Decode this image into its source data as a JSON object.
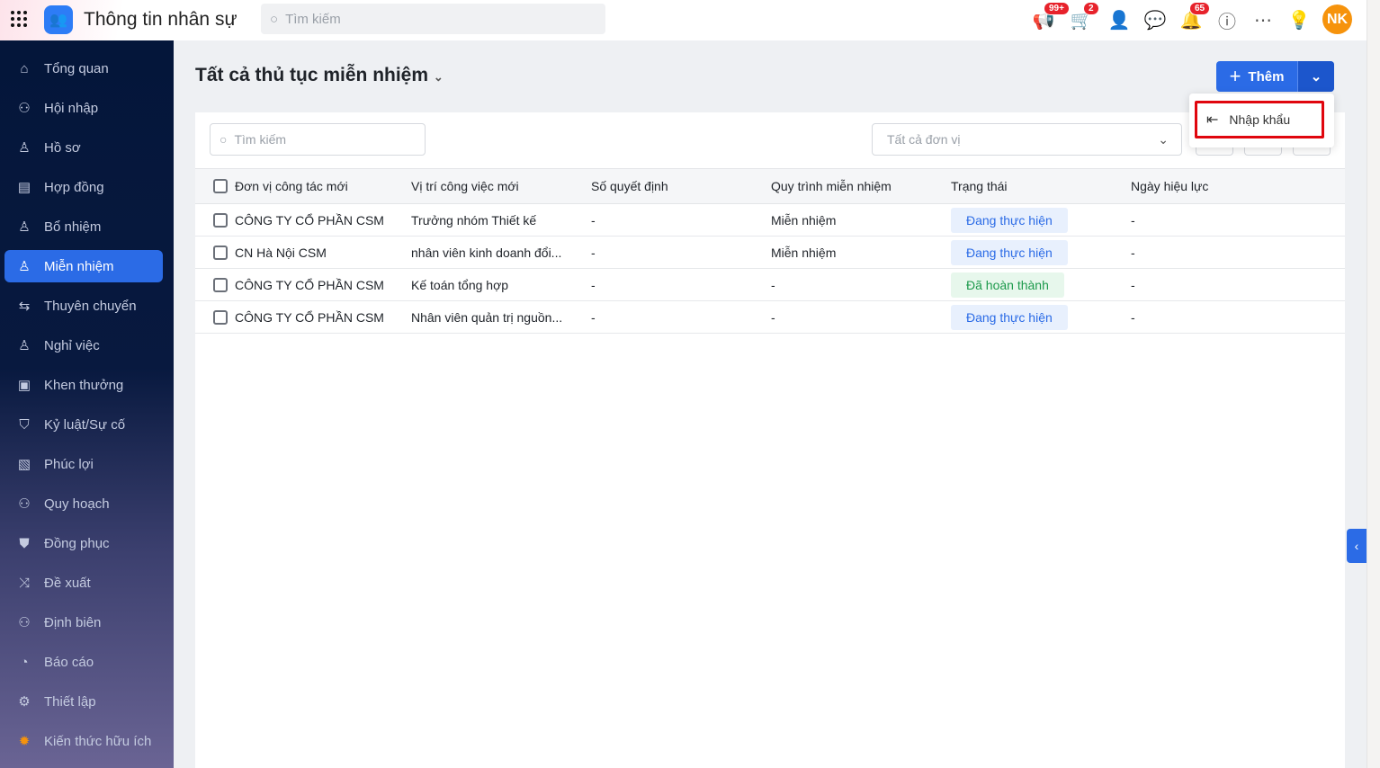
{
  "header": {
    "app_title": "Thông tin nhân sự",
    "search_placeholder": "Tìm kiếm",
    "badges": {
      "announcements": "99+",
      "cart": "2",
      "notifications": "65"
    },
    "avatar_initials": "NK"
  },
  "sidebar": {
    "items": [
      {
        "label": "Tổng quan",
        "icon": "home-icon"
      },
      {
        "label": "Hội nhập",
        "icon": "users-icon"
      },
      {
        "label": "Hồ sơ",
        "icon": "user-icon"
      },
      {
        "label": "Hợp đồng",
        "icon": "document-icon"
      },
      {
        "label": "Bổ nhiệm",
        "icon": "user-plus-icon"
      },
      {
        "label": "Miễn nhiệm",
        "icon": "user-minus-icon",
        "active": true
      },
      {
        "label": "Thuyên chuyển",
        "icon": "transfer-icon"
      },
      {
        "label": "Nghỉ việc",
        "icon": "user-leave-icon"
      },
      {
        "label": "Khen thưởng",
        "icon": "reward-icon"
      },
      {
        "label": "Kỷ luật/Sự cố",
        "icon": "shield-icon"
      },
      {
        "label": "Phúc lợi",
        "icon": "benefit-icon"
      },
      {
        "label": "Quy hoạch",
        "icon": "planning-icon"
      },
      {
        "label": "Đồng phục",
        "icon": "shirt-icon"
      },
      {
        "label": "Đề xuất",
        "icon": "proposal-icon"
      },
      {
        "label": "Định biên",
        "icon": "headcount-icon"
      },
      {
        "label": "Báo cáo",
        "icon": "pie-chart-icon"
      },
      {
        "label": "Thiết lập",
        "icon": "gear-icon"
      },
      {
        "label": "Kiến thức hữu ích",
        "icon": "lightbulb-book-icon"
      }
    ]
  },
  "main": {
    "title": "Tất cả thủ tục miễn nhiệm",
    "add_label": "Thêm",
    "dropdown_menu": {
      "import_label": "Nhập khẩu"
    },
    "search_placeholder": "Tìm kiếm",
    "unit_filter_placeholder": "Tất cả đơn vị",
    "table": {
      "columns": [
        "Đơn vị công tác mới",
        "Vị trí công việc mới",
        "Số quyết định",
        "Quy trình miễn nhiệm",
        "Trạng thái",
        "Ngày hiệu lực"
      ],
      "rows": [
        {
          "unit": "CÔNG TY CỔ PHẦN CSM",
          "position": "Trưởng nhóm Thiết kế",
          "decision": "-",
          "process": "Miễn nhiệm",
          "status": "Đang thực hiện",
          "status_type": "prog",
          "date": "-"
        },
        {
          "unit": "CN Hà Nội CSM",
          "position": "nhân viên kinh doanh đổi...",
          "decision": "-",
          "process": "Miễn nhiệm",
          "status": "Đang thực hiện",
          "status_type": "prog",
          "date": "-"
        },
        {
          "unit": "CÔNG TY CỔ PHẦN CSM",
          "position": "Kế toán tổng hợp",
          "decision": "-",
          "process": "-",
          "status": "Đã hoàn thành",
          "status_type": "done",
          "date": "-"
        },
        {
          "unit": "CÔNG TY CỔ PHẦN CSM",
          "position": "Nhân viên quản trị nguồn...",
          "decision": "-",
          "process": "-",
          "status": "Đang thực hiện",
          "status_type": "prog",
          "date": "-"
        }
      ]
    }
  }
}
